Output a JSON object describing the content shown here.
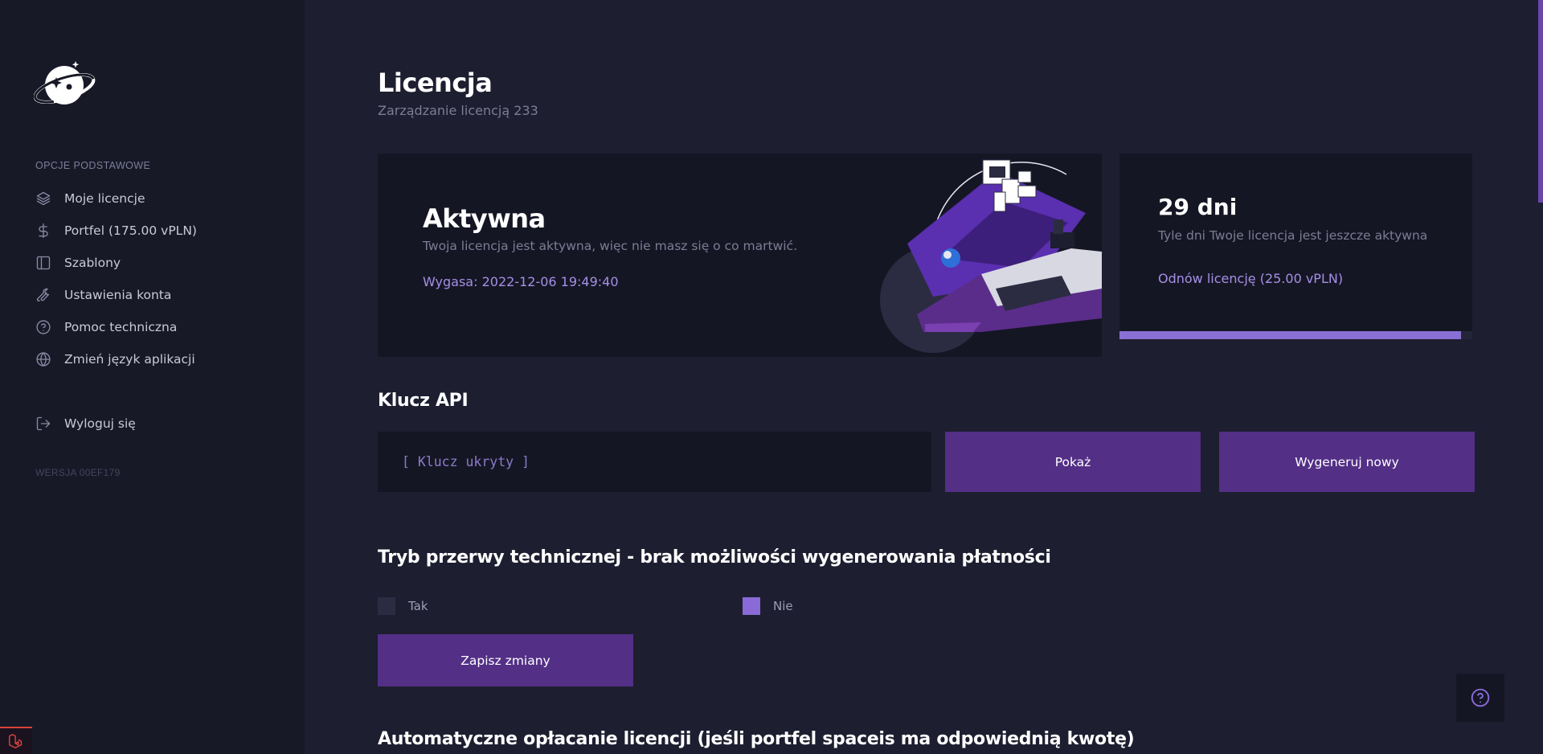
{
  "sidebar": {
    "section_label": "OPCJE PODSTAWOWE",
    "items": [
      {
        "label": "Moje licencje",
        "icon": "layers-icon"
      },
      {
        "label": "Portfel (175.00 vPLN)",
        "icon": "dollar-icon"
      },
      {
        "label": "Szablony",
        "icon": "layout-icon"
      },
      {
        "label": "Ustawienia konta",
        "icon": "wrench-icon"
      },
      {
        "label": "Pomoc techniczna",
        "icon": "help-circle-icon"
      },
      {
        "label": "Zmień język aplikacji",
        "icon": "globe-icon"
      }
    ],
    "logout_label": "Wyloguj się",
    "version": "WERSJA 00EF179"
  },
  "header": {
    "title": "Licencja",
    "subtitle": "Zarządzanie licencją 233"
  },
  "status_card": {
    "title": "Aktywna",
    "description": "Twoja licencja jest aktywna, więc nie masz się o co martwić.",
    "expires": "Wygasa: 2022-12-06 19:49:40"
  },
  "days_card": {
    "title": "29 dni",
    "description": "Tyle dni Twoje licencja jest jeszcze aktywna",
    "renew_link": "Odnów licencję (25.00 vPLN)",
    "progress_fraction": 0.967
  },
  "api_key": {
    "heading": "Klucz API",
    "field_value": "[ Klucz ukryty ]",
    "show_button": "Pokaż",
    "generate_button": "Wygeneruj nowy"
  },
  "maintenance": {
    "heading": "Tryb przerwy technicznej - brak możliwości wygenerowania płatności",
    "option_yes": "Tak",
    "option_no": "Nie",
    "selected": "Nie",
    "save_button": "Zapisz zmiany"
  },
  "autopay": {
    "heading": "Automatyczne opłacanie licencji (jeśli portfel spaceis ma odpowiednią kwotę)"
  },
  "colors": {
    "accent": "#532f86",
    "accent_light": "#a58fe6",
    "background": "#1d1e30",
    "sidebar": "#181927",
    "card": "#151624"
  }
}
